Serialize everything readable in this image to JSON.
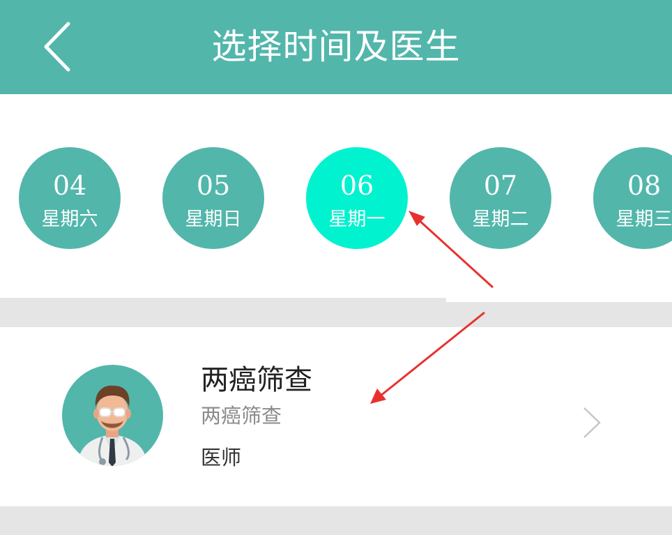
{
  "header": {
    "title": "选择时间及医生",
    "back_icon": "chevron-left-icon"
  },
  "dates": [
    {
      "day": "04",
      "weekday": "星期六",
      "selected": false
    },
    {
      "day": "05",
      "weekday": "星期日",
      "selected": false
    },
    {
      "day": "06",
      "weekday": "星期一",
      "selected": true
    },
    {
      "day": "07",
      "weekday": "星期二",
      "selected": false
    },
    {
      "day": "08",
      "weekday": "星期三",
      "selected": false
    }
  ],
  "doctor": {
    "name": "两癌筛查",
    "department": "两癌筛查",
    "title": "医师",
    "avatar_icon": "doctor-avatar-icon",
    "arrow_icon": "chevron-right-icon"
  },
  "colors": {
    "primary": "#52b6ab",
    "selected": "#00f2cf",
    "background": "#e5e5e5",
    "annotation": "#e8312f"
  }
}
